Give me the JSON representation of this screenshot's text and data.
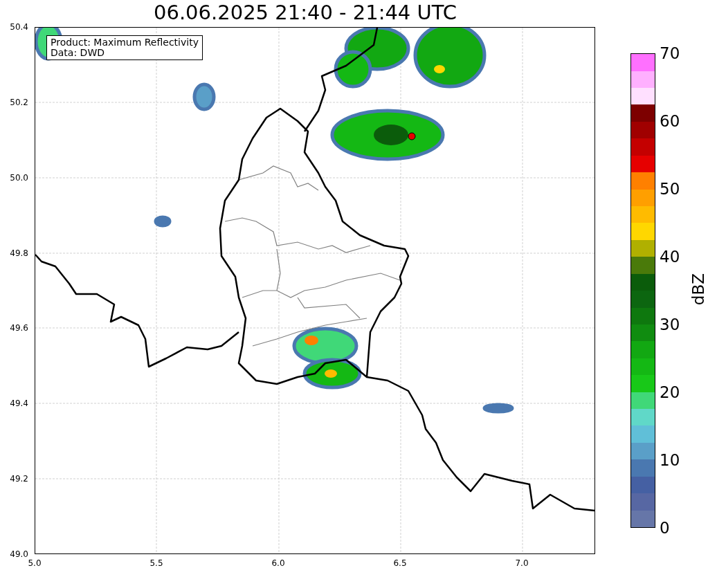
{
  "title": "06.06.2025 21:40 - 21:44 UTC",
  "info_box": [
    "Product: Maximum Reflectivity",
    "Data: DWD"
  ],
  "x_ticks": [
    "5.0",
    "5.5",
    "6.0",
    "6.5",
    "7.0"
  ],
  "y_ticks": [
    "50.4",
    "50.2",
    "50.0",
    "49.8",
    "49.6",
    "49.4",
    "49.2",
    "49.0"
  ],
  "colorbar": {
    "label": "dBZ",
    "ticks": [
      "70",
      "60",
      "50",
      "40",
      "30",
      "20",
      "10",
      "0"
    ],
    "bands": [
      {
        "color": "#6676a8"
      },
      {
        "color": "#5767a3"
      },
      {
        "color": "#4560a3"
      },
      {
        "color": "#4a78b0"
      },
      {
        "color": "#5a9fc8"
      },
      {
        "color": "#60bfd8"
      },
      {
        "color": "#60d8c8"
      },
      {
        "color": "#40d878"
      },
      {
        "color": "#18c818"
      },
      {
        "color": "#14b814"
      },
      {
        "color": "#12a812"
      },
      {
        "color": "#108c10"
      },
      {
        "color": "#0e780e"
      },
      {
        "color": "#0c6610"
      },
      {
        "color": "#0b5c0b"
      },
      {
        "color": "#4a7a0a"
      },
      {
        "color": "#b0b000"
      },
      {
        "color": "#ffd700"
      },
      {
        "color": "#ffbb00"
      },
      {
        "color": "#ff9f00"
      },
      {
        "color": "#ff8000"
      },
      {
        "color": "#e60000"
      },
      {
        "color": "#c40000"
      },
      {
        "color": "#a00000"
      },
      {
        "color": "#7d0000"
      },
      {
        "color": "#ffe0ff"
      },
      {
        "color": "#ffb0ff"
      },
      {
        "color": "#ff70ff"
      }
    ]
  }
}
